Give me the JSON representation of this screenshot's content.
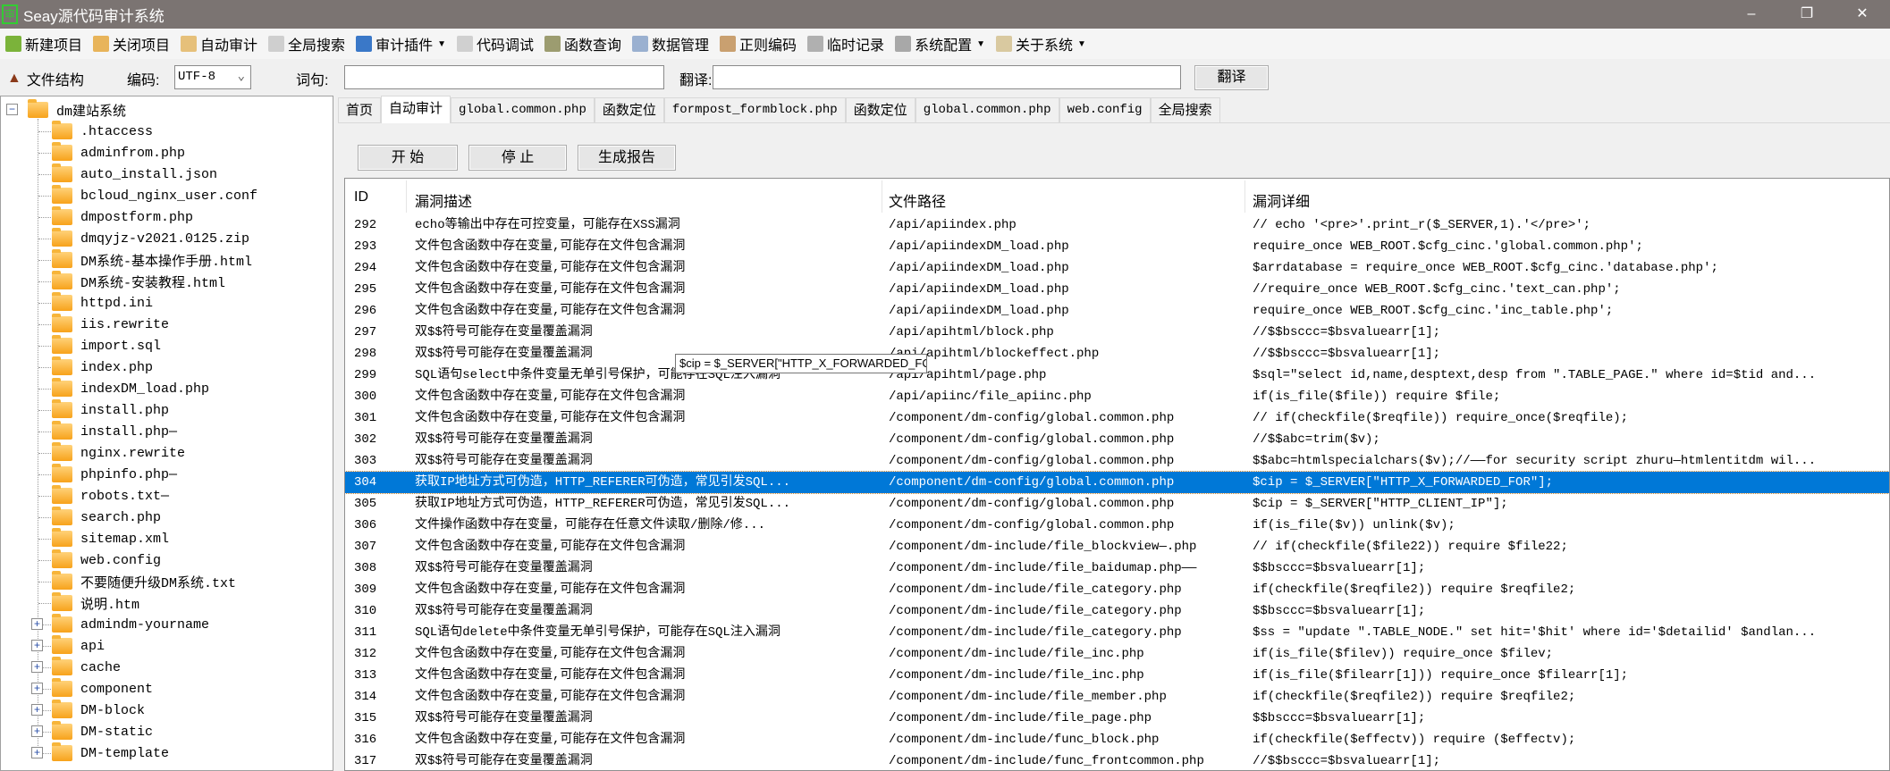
{
  "window": {
    "title": "Seay源代码审计系统",
    "logo_char": "审"
  },
  "toolbar": [
    {
      "label": "新建项目",
      "icon": "new-project-icon",
      "color": "#7bb33a"
    },
    {
      "label": "关闭项目",
      "icon": "close-project-icon",
      "color": "#e8b45a"
    },
    {
      "label": "自动审计",
      "icon": "auto-audit-icon",
      "color": "#e6c07a"
    },
    {
      "label": "全局搜索",
      "icon": "magnifier-icon",
      "color": "#cfcfcf"
    },
    {
      "label": "审计插件",
      "icon": "plugin-icon",
      "color": "#3a78c8",
      "dropdown": true
    },
    {
      "label": "代码调试",
      "icon": "lightning-icon",
      "color": "#d0d0d0"
    },
    {
      "label": "函数查询",
      "icon": "search-icon",
      "color": "#9c9c70"
    },
    {
      "label": "数据管理",
      "icon": "database-icon",
      "color": "#9ab0d0"
    },
    {
      "label": "正则编码",
      "icon": "regex-icon",
      "color": "#c9a070"
    },
    {
      "label": "临时记录",
      "icon": "notepad-icon",
      "color": "#b0b0b0"
    },
    {
      "label": "系统配置",
      "icon": "gear-icon",
      "color": "#a8a8a8",
      "dropdown": true
    },
    {
      "label": "关于系统",
      "icon": "about-icon",
      "color": "#d9c9a0",
      "dropdown": true
    }
  ],
  "bar2": {
    "file_structure": "文件结构",
    "encoding_label": "编码:",
    "encoding_value": "UTF-8",
    "phrase_label": "词句:",
    "phrase_value": "",
    "translate_label": "翻译:",
    "translate_value": "",
    "translate_button": "翻译"
  },
  "tree": {
    "root": "dm建站系统",
    "files": [
      ".htaccess",
      "adminfrom.php",
      "auto_install.json",
      "bcloud_nginx_user.conf",
      "dmpostform.php",
      "dmqyjz-v2021.0125.zip",
      "DM系统-基本操作手册.html",
      "DM系统-安装教程.html",
      "httpd.ini",
      "iis.rewrite",
      "import.sql",
      "index.php",
      "indexDM_load.php",
      "install.php",
      "install.php—",
      "nginx.rewrite",
      "phpinfo.php—",
      "robots.txt—",
      "search.php",
      "sitemap.xml",
      "web.config",
      "不要随便升级DM系统.txt",
      "说明.htm"
    ],
    "folders": [
      "admindm-yourname",
      "api",
      "cache",
      "component",
      "DM-block",
      "DM-static",
      "DM-template"
    ]
  },
  "tabs": [
    {
      "label": "首页",
      "mono": false
    },
    {
      "label": "自动审计",
      "mono": false,
      "active": true
    },
    {
      "label": "global.common.php",
      "mono": true
    },
    {
      "label": "函数定位",
      "mono": false
    },
    {
      "label": "formpost_formblock.php",
      "mono": true
    },
    {
      "label": "函数定位",
      "mono": false
    },
    {
      "label": "global.common.php",
      "mono": true
    },
    {
      "label": "web.config",
      "mono": true
    },
    {
      "label": "全局搜索",
      "mono": false
    }
  ],
  "actions": {
    "start": "开 始",
    "stop": "停 止",
    "report": "生成报告"
  },
  "table": {
    "columns": [
      "ID",
      "漏洞描述",
      "文件路径",
      "漏洞详细"
    ],
    "selected_id": "304",
    "rows": [
      [
        "292",
        "echo等输出中存在可控变量，可能存在XSS漏洞",
        "/api/apiindex.php",
        "// echo '<pre>'.print_r($_SERVER,1).'</pre>';"
      ],
      [
        "293",
        "文件包含函数中存在变量,可能存在文件包含漏洞",
        "/api/apiindexDM_load.php",
        "require_once WEB_ROOT.$cfg_cinc.'global.common.php';"
      ],
      [
        "294",
        "文件包含函数中存在变量,可能存在文件包含漏洞",
        "/api/apiindexDM_load.php",
        "$arrdatabase =  require_once WEB_ROOT.$cfg_cinc.'database.php';"
      ],
      [
        "295",
        "文件包含函数中存在变量,可能存在文件包含漏洞",
        "/api/apiindexDM_load.php",
        "//require_once WEB_ROOT.$cfg_cinc.'text_can.php';"
      ],
      [
        "296",
        "文件包含函数中存在变量,可能存在文件包含漏洞",
        "/api/apiindexDM_load.php",
        "require_once WEB_ROOT.$cfg_cinc.'inc_table.php';"
      ],
      [
        "297",
        "双$$符号可能存在变量覆盖漏洞",
        "/api/apihtml/block.php",
        "//$$bsccc=$bsvaluearr[1];"
      ],
      [
        "298",
        "双$$符号可能存在变量覆盖漏洞",
        "/api/apihtml/blockeffect.php",
        "//$$bsccc=$bsvaluearr[1];"
      ],
      [
        "299",
        "SQL语句select中条件变量无单引号保护，可能存在SQL注入漏洞",
        "/api/apihtml/page.php",
        "$sql=\"select id,name,desptext,desp  from \".TABLE_PAGE.\" where  id=$tid and..."
      ],
      [
        "300",
        "文件包含函数中存在变量,可能存在文件包含漏洞",
        "/api/apiinc/file_apiinc.php",
        "if(is_file($file)) require $file;"
      ],
      [
        "301",
        "文件包含函数中存在变量,可能存在文件包含漏洞",
        "/component/dm-config/global.common.php",
        "// if(checkfile($reqfile)) require_once($reqfile);"
      ],
      [
        "302",
        "双$$符号可能存在变量覆盖漏洞",
        "/component/dm-config/global.common.php",
        "//$$abc=trim($v);"
      ],
      [
        "303",
        "双$$符号可能存在变量覆盖漏洞",
        "/component/dm-config/global.common.php",
        "$$abc=htmlspecialchars($v);//——for security script zhuru—htmlentitdm wil..."
      ],
      [
        "304",
        "获取IP地址方式可伪造，HTTP_REFERER可伪造，常见引发SQL...",
        "/component/dm-config/global.common.php",
        "$cip = $_SERVER[\"HTTP_X_FORWARDED_FOR\"];"
      ],
      [
        "305",
        "获取IP地址方式可伪造，HTTP_REFERER可伪造，常见引发SQL...",
        "/component/dm-config/global.common.php",
        "$cip = $_SERVER[\"HTTP_CLIENT_IP\"];"
      ],
      [
        "306",
        "文件操作函数中存在变量，可能存在任意文件读取/删除/修...",
        "/component/dm-config/global.common.php",
        "if(is_file($v))     unlink($v);"
      ],
      [
        "307",
        "文件包含函数中存在变量,可能存在文件包含漏洞",
        "/component/dm-include/file_blockview—.php",
        "// if(checkfile($file22)) require $file22;"
      ],
      [
        "308",
        "双$$符号可能存在变量覆盖漏洞",
        "/component/dm-include/file_baidumap.php——",
        "$$bsccc=$bsvaluearr[1];"
      ],
      [
        "309",
        "文件包含函数中存在变量,可能存在文件包含漏洞",
        "/component/dm-include/file_category.php",
        "if(checkfile($reqfile2))  require  $reqfile2;"
      ],
      [
        "310",
        "双$$符号可能存在变量覆盖漏洞",
        "/component/dm-include/file_category.php",
        "$$bsccc=$bsvaluearr[1];"
      ],
      [
        "311",
        "SQL语句delete中条件变量无单引号保护，可能存在SQL注入漏洞",
        "/component/dm-include/file_category.php",
        "$ss = \"update \".TABLE_NODE.\" set  hit='$hit'  where id='$detailid' $andlan..."
      ],
      [
        "312",
        "文件包含函数中存在变量,可能存在文件包含漏洞",
        "/component/dm-include/file_inc.php",
        "if(is_file($filev)) require_once $filev;"
      ],
      [
        "313",
        "文件包含函数中存在变量,可能存在文件包含漏洞",
        "/component/dm-include/file_inc.php",
        "if(is_file($filearr[1])) require_once $filearr[1];"
      ],
      [
        "314",
        "文件包含函数中存在变量,可能存在文件包含漏洞",
        "/component/dm-include/file_member.php",
        "if(checkfile($reqfile2))  require  $reqfile2;"
      ],
      [
        "315",
        "双$$符号可能存在变量覆盖漏洞",
        "/component/dm-include/file_page.php",
        "$$bsccc=$bsvaluearr[1];"
      ],
      [
        "316",
        "文件包含函数中存在变量,可能存在文件包含漏洞",
        "/component/dm-include/func_block.php",
        "if(checkfile($effectv)) require ($effectv);"
      ],
      [
        "317",
        "双$$符号可能存在变量覆盖漏洞",
        "/component/dm-include/func_frontcommon.php",
        "//$$bsccc=$bsvaluearr[1];"
      ]
    ]
  },
  "tooltip": "$cip = $_SERVER[\"HTTP_X_FORWARDED_FOR\"];",
  "colors": {
    "selection": "#0078d7",
    "titlebar": "#7b7472",
    "folder": "#f7a21b"
  }
}
